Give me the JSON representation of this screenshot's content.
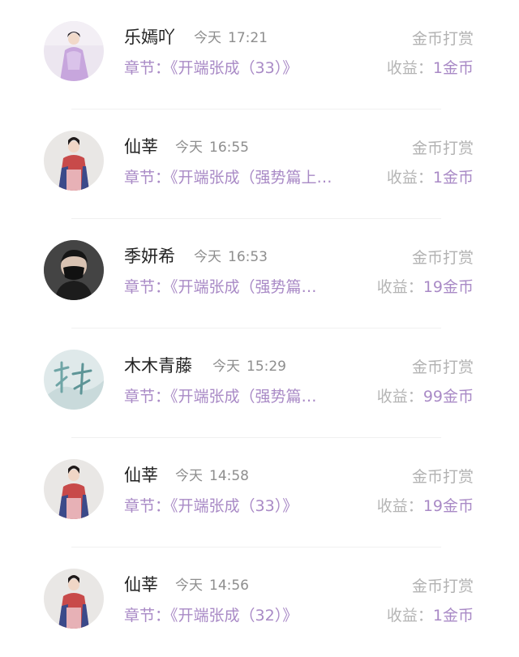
{
  "records": [
    {
      "name": "乐嫣吖",
      "day": "今天",
      "time": "17:21",
      "action": "金币打赏",
      "chapter_prefix": "章节：",
      "chapter": "《开端张成（33）》",
      "income_label": "收益：",
      "income": "1金币",
      "avatar": "avatar-pink-hanfu"
    },
    {
      "name": "仙莘",
      "day": "今天",
      "time": "16:55",
      "action": "金币打赏",
      "chapter_prefix": "章节：",
      "chapter": "《开端张成（强势篇上…",
      "income_label": "收益：",
      "income": "1金币",
      "avatar": "avatar-red-hanfu"
    },
    {
      "name": "季妍希",
      "day": "今天",
      "time": "16:53",
      "action": "金币打赏",
      "chapter_prefix": "章节：",
      "chapter": "《开端张成（强势篇…",
      "income_label": "收益：",
      "income": "19金币",
      "avatar": "avatar-masked-man"
    },
    {
      "name": "木木青藤",
      "day": "今天",
      "time": "15:29",
      "action": "金币打赏",
      "chapter_prefix": "章节：",
      "chapter": "《开端张成（强势篇…",
      "income_label": "收益：",
      "income": "99金币",
      "avatar": "avatar-vine-art"
    },
    {
      "name": "仙莘",
      "day": "今天",
      "time": "14:58",
      "action": "金币打赏",
      "chapter_prefix": "章节：",
      "chapter": "《开端张成（33）》",
      "income_label": "收益：",
      "income": "19金币",
      "avatar": "avatar-red-hanfu"
    },
    {
      "name": "仙莘",
      "day": "今天",
      "time": "14:56",
      "action": "金币打赏",
      "chapter_prefix": "章节：",
      "chapter": "《开端张成（32）》",
      "income_label": "收益：",
      "income": "1金币",
      "avatar": "avatar-red-hanfu"
    }
  ],
  "colors": {
    "accent": "#a98ac6",
    "muted": "#b2b2b2",
    "name": "#222222"
  }
}
